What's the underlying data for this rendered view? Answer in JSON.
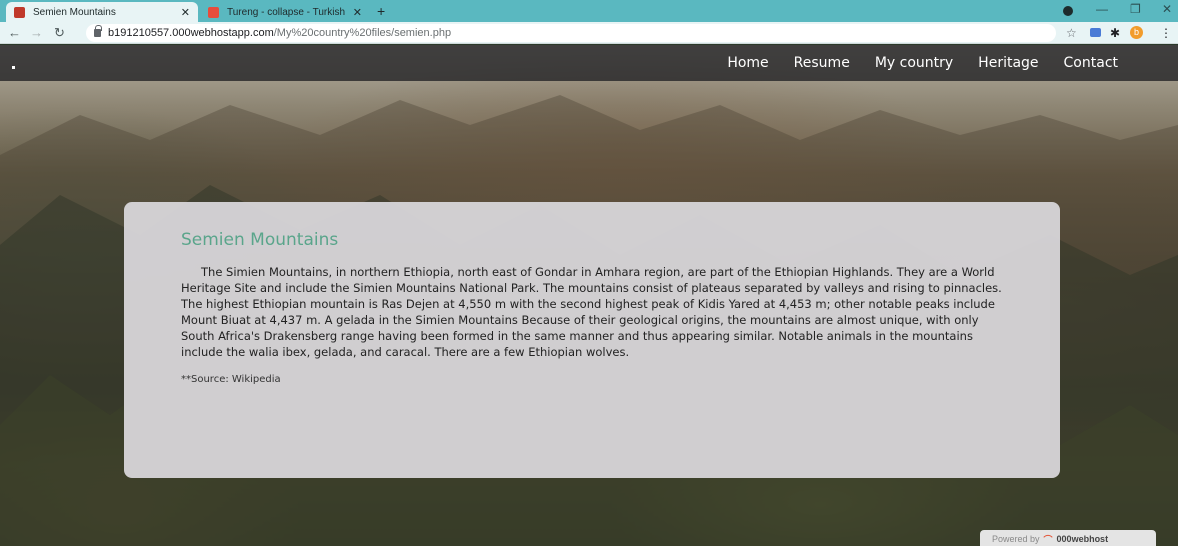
{
  "browser": {
    "tabs": [
      {
        "title": "Semien Mountains",
        "active": true,
        "favicon_color": "#c0392b"
      },
      {
        "title": "Tureng - collapse - Turkish English",
        "active": false,
        "favicon_color": "#e74c3c"
      }
    ],
    "url_host": "b191210557.000webhostapp.com",
    "url_path": "/My%20country%20files/semien.php",
    "avatar_letter": "b",
    "icons": [
      "back-arrow-icon",
      "forward-arrow-icon",
      "reload-icon",
      "lock-icon",
      "star-icon",
      "extensions-icon",
      "puzzle-icon",
      "menu-icon"
    ]
  },
  "site": {
    "nav": [
      {
        "label": "Home"
      },
      {
        "label": "Resume"
      },
      {
        "label": "My country"
      },
      {
        "label": "Heritage"
      },
      {
        "label": "Contact"
      }
    ],
    "article": {
      "title": "Semien Mountains",
      "body": "The Simien Mountains, in northern Ethiopia, north east of Gondar in Amhara region, are part of the Ethiopian Highlands. They are a World Heritage Site and include the Simien Mountains National Park. The mountains consist of plateaus separated by valleys and rising to pinnacles. The highest Ethiopian mountain is Ras Dejen at 4,550 m with the second highest peak of Kidis Yared at 4,453 m; other notable peaks include Mount Biuat at 4,437 m. A gelada in the Simien Mountains Because of their geological origins, the mountains are almost unique, with only South Africa's Drakensberg range having been formed in the same manner and thus appearing similar. Notable animals in the mountains include the walia ibex, gelada, and caracal. There are a few Ethiopian wolves.",
      "source": "**Source: Wikipedia"
    },
    "powered_by": {
      "prefix": "Powered by",
      "brand": "000webhost"
    },
    "colors": {
      "title": "#5aa58b",
      "chrome": "#5ab8c0"
    }
  }
}
